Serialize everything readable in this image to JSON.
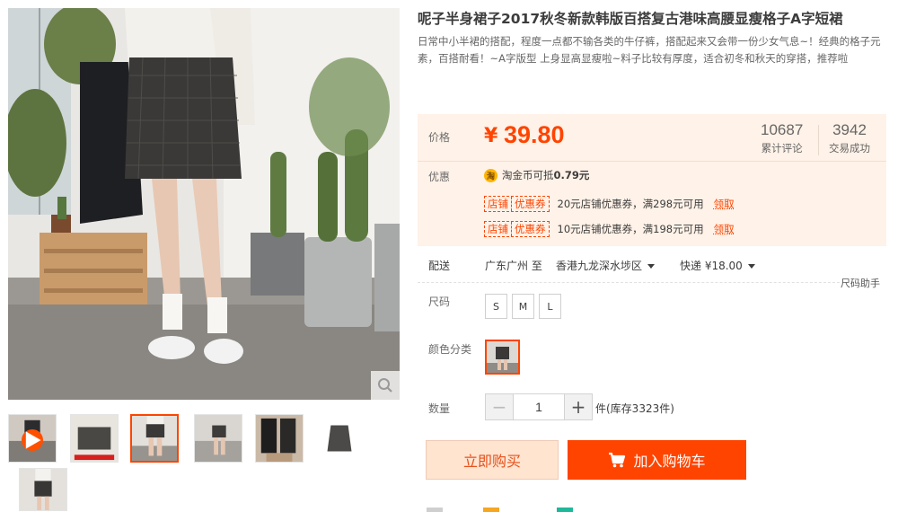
{
  "product": {
    "title": "呢子半身裙子2017秋冬新款韩版百搭复古港味高腰显瘦格子A字短裙",
    "subtitle": "日常中小半裙的搭配，程度一点都不输各类的牛仔裤，搭配起来又会带一份少女气息~！经典的格子元素，百搭耐看！~A字版型 上身显高显瘦啦~料子比较有厚度，适合初冬和秋天的穿搭，推荐啦"
  },
  "price": {
    "label": "价格",
    "currency_symbol": "¥",
    "value": "39.80",
    "reviews_count": "10687",
    "reviews_label": "累计评论",
    "sales_count": "3942",
    "sales_label": "交易成功"
  },
  "promo": {
    "label": "优惠",
    "coin_icon_char": "淘",
    "coin_text": "淘金币可抵",
    "coin_amount": "0.79元",
    "coupon_tag_left": "店铺",
    "coupon_tag_right": "优惠券",
    "get_label": "领取",
    "coupons": [
      {
        "text": "20元店铺优惠券，满298元可用"
      },
      {
        "text": "10元店铺优惠券，满198元可用"
      }
    ]
  },
  "shipping": {
    "label": "配送",
    "from": "广东广州 至",
    "to": "香港九龙深水埗区",
    "method": "快递 ¥18.00"
  },
  "size": {
    "label": "尺码",
    "helper": "尺码助手",
    "options": [
      "S",
      "M",
      "L"
    ]
  },
  "color": {
    "label": "颜色分类"
  },
  "quantity": {
    "label": "数量",
    "value": "1",
    "minus": "−",
    "plus": "+",
    "stock": "件(库存3323件)"
  },
  "actions": {
    "buy": "立即购买",
    "cart": "加入购物车"
  },
  "colors": {
    "accent": "#ff4400",
    "price_bg": "#fff2e8",
    "buy_bg": "#ffe4d0"
  },
  "icons": [
    "zoom-icon",
    "play-icon",
    "coin-icon",
    "cart-icon",
    "caret-down-icon"
  ]
}
